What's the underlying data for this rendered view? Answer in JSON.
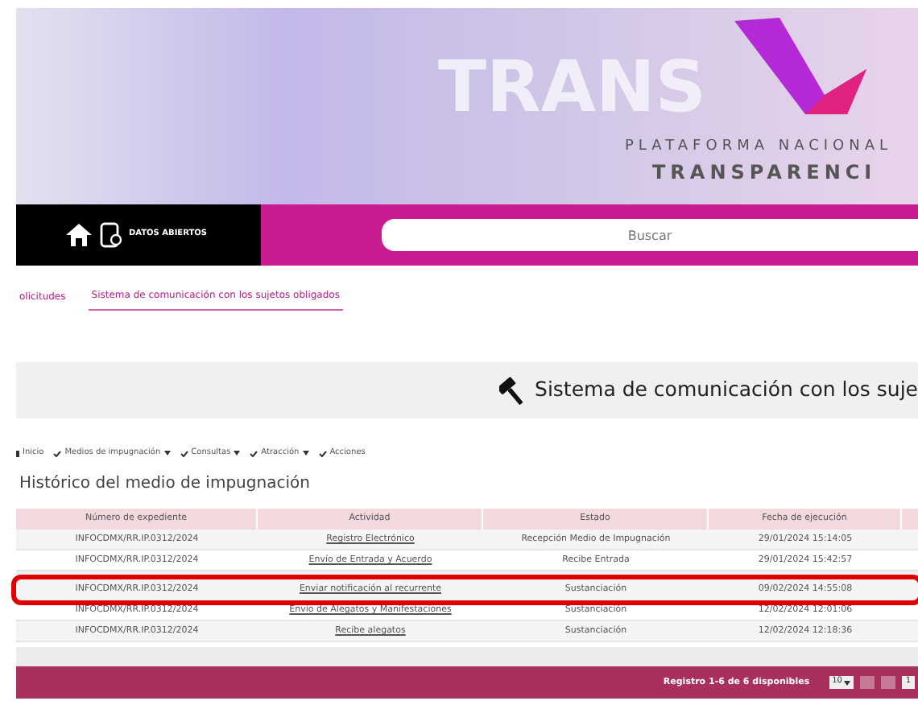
{
  "banner": {
    "watermark": "TRANS",
    "subtitle": "PLATAFORMA NACIONAL",
    "title": "TRANSPARENCI"
  },
  "navbar": {
    "link": "DATOS ABIERTOS",
    "search": {
      "placeholder": "Buscar"
    }
  },
  "tabs": [
    {
      "label": "olicitudes",
      "selected": false
    },
    {
      "label": "Sistema de comunicación con los sujetos obligados",
      "selected": true
    }
  ],
  "page_title": "Sistema de comunicación con los suje",
  "menu": [
    {
      "label": "Inicio",
      "kind": "home"
    },
    {
      "label": "Medios de impugnación",
      "kind": "dropdown"
    },
    {
      "label": "Consultas",
      "kind": "dropdown"
    },
    {
      "label": "Atracción",
      "kind": "dropdown"
    },
    {
      "label": "Acciones",
      "kind": "link"
    }
  ],
  "section_title": "Histórico del medio de impugnación",
  "table": {
    "columns": [
      "Número de expediente",
      "Actividad",
      "Estado",
      "Fecha de ejecución"
    ],
    "rows": [
      {
        "cells": [
          "INFOCDMX/RR.IP.0312/2024",
          "Registro Electrónico",
          "Recepción Medio de Impugnación",
          "29/01/2024 15:14:05"
        ],
        "highlighted": false
      },
      {
        "cells": [
          "INFOCDMX/RR.IP.0312/2024",
          "Envío de Entrada y Acuerdo",
          "Recibe Entrada",
          "29/01/2024 15:42:57"
        ],
        "highlighted": false
      },
      {
        "cells": [
          "INFOCDMX/RR.IP.0312/2024",
          "Enviar notificación al recurrente",
          "Sustanciación",
          "09/02/2024 14:55:08"
        ],
        "highlighted": true
      },
      {
        "cells": [
          "INFOCDMX/RR.IP.0312/2024",
          "Envío de Alegatos y Manifestaciones",
          "Sustanciación",
          "12/02/2024 12:01:06"
        ],
        "highlighted": false
      },
      {
        "cells": [
          "INFOCDMX/RR.IP.0312/2024",
          "Recibe alegatos",
          "Sustanciación",
          "12/02/2024 12:18:36"
        ],
        "highlighted": false
      }
    ]
  },
  "footer": {
    "records": "Registro 1-6 de 6 disponibles",
    "page_size": "10",
    "page": "1"
  }
}
